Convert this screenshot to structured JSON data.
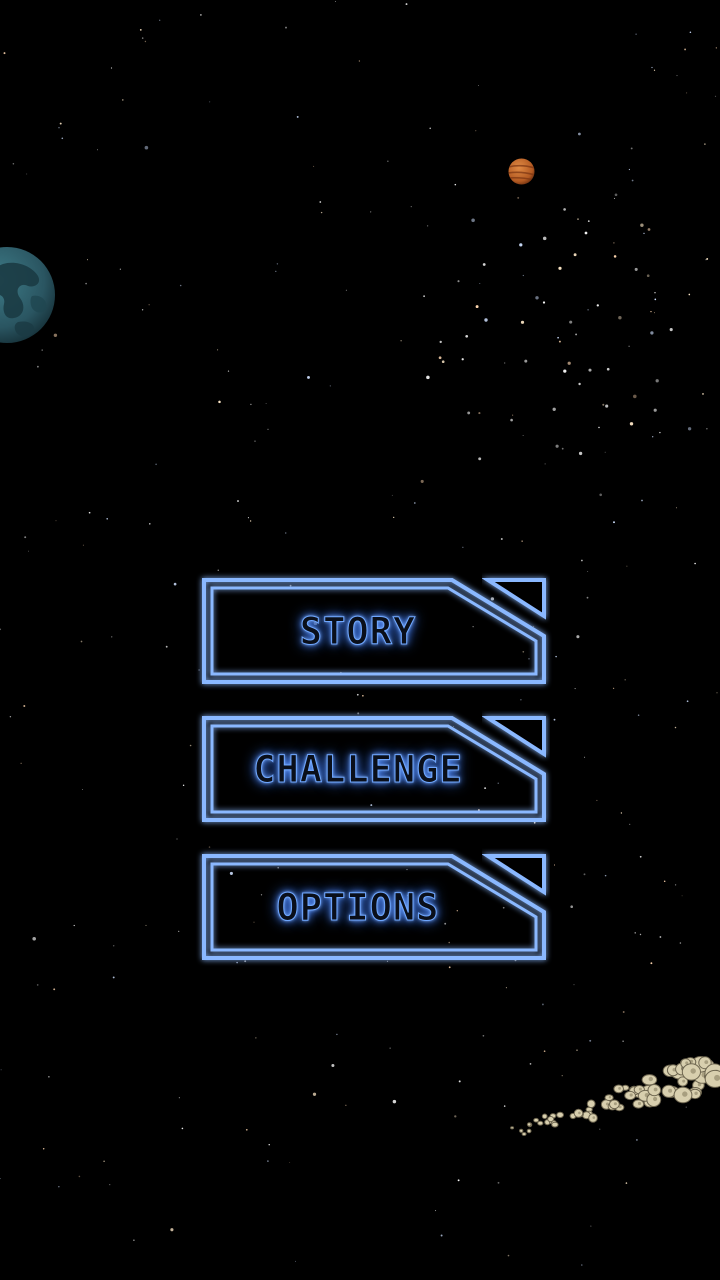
{
  "menu": {
    "story_label": "STORY",
    "challenge_label": "CHALLENGE",
    "options_label": "OPTIONS"
  },
  "colors": {
    "background": "#000000",
    "button_glow": "#6fa7ff",
    "button_stroke": "#9cc4ff",
    "planet_blue": "#2f5d6a",
    "planet_orange": "#c0692b",
    "asteroid": "#d8cfae"
  },
  "icons": {
    "background": "starfield",
    "planet_large": "blue-planet-icon",
    "planet_small": "orange-planet-icon",
    "asteroid_belt": "asteroid-belt-icon"
  }
}
